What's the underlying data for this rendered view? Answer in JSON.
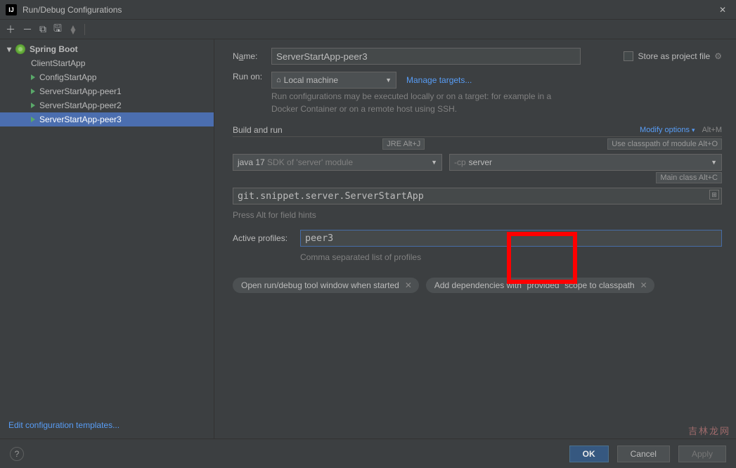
{
  "window": {
    "title": "Run/Debug Configurations"
  },
  "sidebar": {
    "group": "Spring Boot",
    "items": [
      {
        "label": "ClientStartApp"
      },
      {
        "label": "ConfigStartApp"
      },
      {
        "label": "ServerStartApp-peer1"
      },
      {
        "label": "ServerStartApp-peer2"
      },
      {
        "label": "ServerStartApp-peer3"
      }
    ],
    "editTemplates": "Edit configuration templates..."
  },
  "form": {
    "nameLabelPre": "N",
    "nameLabelU": "a",
    "nameLabelPost": "me:",
    "name": "ServerStartApp-peer3",
    "storePre": "S",
    "storeU": "t",
    "storePost": "ore as project file",
    "runOnLabel": "Run on:",
    "runOn": "Local machine",
    "manageTargets": "Manage targets...",
    "runHint": "Run configurations may be executed locally or on a target: for example in a Docker Container or on a remote host using SSH.",
    "buildRun": "Build and run",
    "modifyOptions": "Modify options",
    "altM": "Alt+M",
    "jreHint": "JRE Alt+J",
    "cpHint": "Use classpath of module Alt+O",
    "mainHint": "Main class Alt+C",
    "sdkA": "java 17",
    "sdkB": "SDK of 'server' module",
    "cpPrefix": "-cp",
    "cpVal": "server",
    "mainClass": "git.snippet.server.ServerStartApp",
    "fieldHints": "Press Alt for field hints",
    "apLabel": "Active profiles:",
    "apValue": "peer3",
    "apHint": "Comma separated list of profiles",
    "chip1": "Open run/debug tool window when started",
    "chip2": "Add dependencies with \"provided\" scope to classpath"
  },
  "footer": {
    "ok": "OK",
    "cancel": "Cancel",
    "apply": "Apply"
  },
  "watermark": "吉林龙网"
}
